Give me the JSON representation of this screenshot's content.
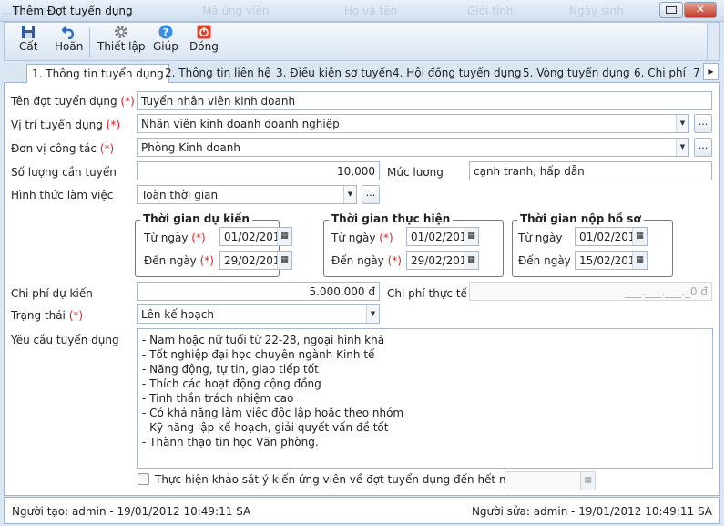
{
  "background_columns": [
    "...ham gia",
    "Mã ứng viên",
    "Họ và tên",
    "Giới tính",
    "Ngày sinh"
  ],
  "window": {
    "title": "Thêm Đợt tuyển dụng"
  },
  "toolbar": [
    {
      "label": "Cất",
      "icon": "save-icon"
    },
    {
      "label": "Hoãn",
      "icon": "undo-icon"
    },
    {
      "label": "Thiết lập",
      "icon": "gear-icon"
    },
    {
      "label": "Giúp",
      "icon": "help-icon"
    },
    {
      "label": "Đóng",
      "icon": "power-icon"
    }
  ],
  "tabs": [
    "1. Thông tin tuyển dụng",
    "2. Thông tin liên hệ",
    "3. Điều kiện sơ tuyển",
    "4. Hội đồng tuyển dụng",
    "5. Vòng tuyển dụng",
    "6. Chi phí",
    "7"
  ],
  "required_mark": "(*)",
  "form": {
    "ten_dot": {
      "label": "Tên đợt tuyển dụng",
      "value": "Tuyển nhân viên kinh doanh"
    },
    "vi_tri": {
      "label": "Vị trí tuyển dụng",
      "value": "Nhân viên kinh doanh doanh nghiệp"
    },
    "don_vi": {
      "label": "Đơn vị công tác",
      "value": "Phòng Kinh doanh"
    },
    "so_luong": {
      "label": "Số lượng cần tuyển",
      "value": "10,000"
    },
    "muc_luong": {
      "label": "Mức lương",
      "value": "cạnh tranh, hấp dẫn"
    },
    "hinh_thuc": {
      "label": "Hình thức làm việc",
      "value": "Toàn thời gian"
    },
    "more_label": "...",
    "groups": [
      {
        "title": "Thời gian dự kiến",
        "from_label": "Từ ngày",
        "to_label": "Đến ngày",
        "from": "01/02/2012",
        "to": "29/02/2012",
        "required": true
      },
      {
        "title": "Thời gian thực hiện",
        "from_label": "Từ ngày",
        "to_label": "Đến ngày",
        "from": "01/02/2012",
        "to": "29/02/2012",
        "required": true
      },
      {
        "title": "Thời gian nộp hồ sơ",
        "from_label": "Từ ngày",
        "to_label": "Đến ngày",
        "from": "01/02/2012",
        "to": "15/02/2012",
        "required": false
      }
    ],
    "chi_phi_du_kien": {
      "label": "Chi phí dự kiến",
      "value": "5.000.000 đ"
    },
    "chi_phi_thuc_te": {
      "label": "Chi phí thực tế",
      "placeholder": "___.___.___._0 đ"
    },
    "trang_thai": {
      "label": "Trạng thái",
      "value": "Lên kế hoạch"
    },
    "yeu_cau": {
      "label": "Yêu cầu tuyển dụng",
      "lines": [
        "- Nam hoặc nữ tuổi từ 22-28, ngoại hình khá",
        "- Tốt nghiệp đại học chuyên ngành Kinh tế",
        "- Năng động, tự tin, giao tiếp tốt",
        "- Thích các hoạt động cộng đồng",
        "- Tinh thần trách nhiệm cao",
        "- Có khả năng làm việc độc lập hoặc theo nhóm",
        "- Kỹ năng lập kế hoạch, giải quyết vấn đề tốt",
        "- Thành thạo tin học Văn phòng."
      ]
    },
    "khao_sat": {
      "label": "Thực hiện khảo sát ý kiến ứng viên về đợt tuyển dụng đến hết ngày",
      "checked": false,
      "value": ""
    }
  },
  "status": {
    "created": "Người tạo: admin - 19/01/2012 10:49:11 SA",
    "modified": "Người sửa: admin - 19/01/2012 10:49:11 SA"
  }
}
